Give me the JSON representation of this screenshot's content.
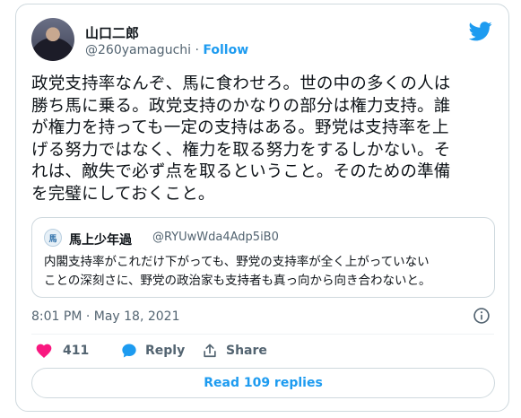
{
  "author": {
    "display_name": "山口二郎",
    "handle": "@260yamaguchi",
    "separator": "·",
    "follow_label": "Follow"
  },
  "tweet": {
    "text_lines": [
      "政党支持率なんぞ、馬に食わせろ。世の中の多くの人は",
      "勝ち馬に乗る。政党支持のかなりの部分は権力支持。誰",
      "が権力を持っても一定の支持はある。野党は支持率を上",
      "げる努力ではなく、権力を取る努力をするしかない。そ",
      "れは、敵失で必ず点を取るということ。そのための準備",
      "を完璧にしておくこと。"
    ],
    "timestamp": "8:01 PM · May 18, 2021"
  },
  "quoted_tweet": {
    "avatar_text": "馬",
    "display_name": "馬上少年過",
    "handle": "@RYUwWda4Adp5iB0",
    "text_lines": [
      "内閣支持率がこれだけ下がっても、野党の支持率が全く上がっていない",
      "ことの深刻さに、野党の政治家も支持者も真っ向から向き合わないと。"
    ]
  },
  "actions": {
    "like_count": "411",
    "reply_label": "Reply",
    "share_label": "Share"
  },
  "read_replies_label": "Read 109 replies",
  "colors": {
    "accent": "#1d9bf0",
    "like": "#f91880",
    "secondary_text": "#536471",
    "border": "#cfd9de"
  },
  "icons": [
    "twitter-bird-icon",
    "info-icon",
    "heart-icon",
    "reply-bubble-icon",
    "share-icon"
  ]
}
